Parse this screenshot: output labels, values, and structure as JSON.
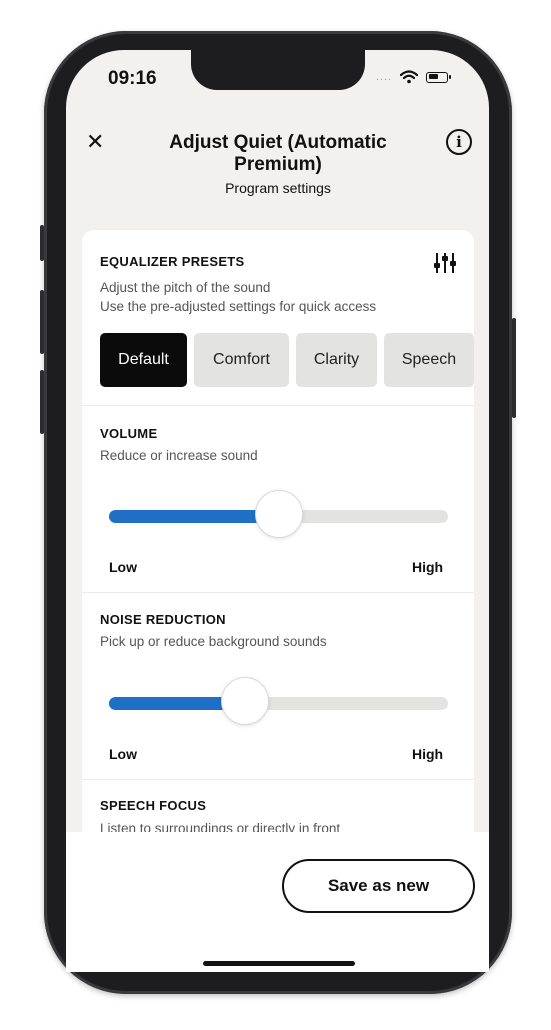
{
  "status_bar": {
    "time": "09:16",
    "dots": "....",
    "icons": [
      "wifi-icon",
      "battery-icon"
    ]
  },
  "header": {
    "title": "Adjust Quiet (Automatic Premium)",
    "subtitle": "Program settings",
    "close_glyph": "✕",
    "info_glyph": "i"
  },
  "equalizer": {
    "title": "EQUALIZER PRESETS",
    "desc_line1": "Adjust the pitch of the sound",
    "desc_line2": "Use the pre-adjusted settings for quick access",
    "icon": "equalizer-settings-icon",
    "presets": [
      "Default",
      "Comfort",
      "Clarity",
      "Speech"
    ],
    "selected": "Default"
  },
  "volume": {
    "title": "VOLUME",
    "desc": "Reduce or increase sound",
    "level": 0.5,
    "low_label": "Low",
    "high_label": "High"
  },
  "noise_reduction": {
    "title": "NOISE REDUCTION",
    "desc": "Pick up or reduce background sounds",
    "level": 0.4,
    "low_label": "Low",
    "high_label": "High"
  },
  "speech_focus": {
    "title": "SPEECH FOCUS",
    "desc": "Listen to surroundings or directly in front"
  },
  "footer": {
    "save_label": "Save as new"
  },
  "colors": {
    "accent": "#1f6fc6",
    "background": "#f2f1ef",
    "selected_preset": "#0b0b0b"
  }
}
